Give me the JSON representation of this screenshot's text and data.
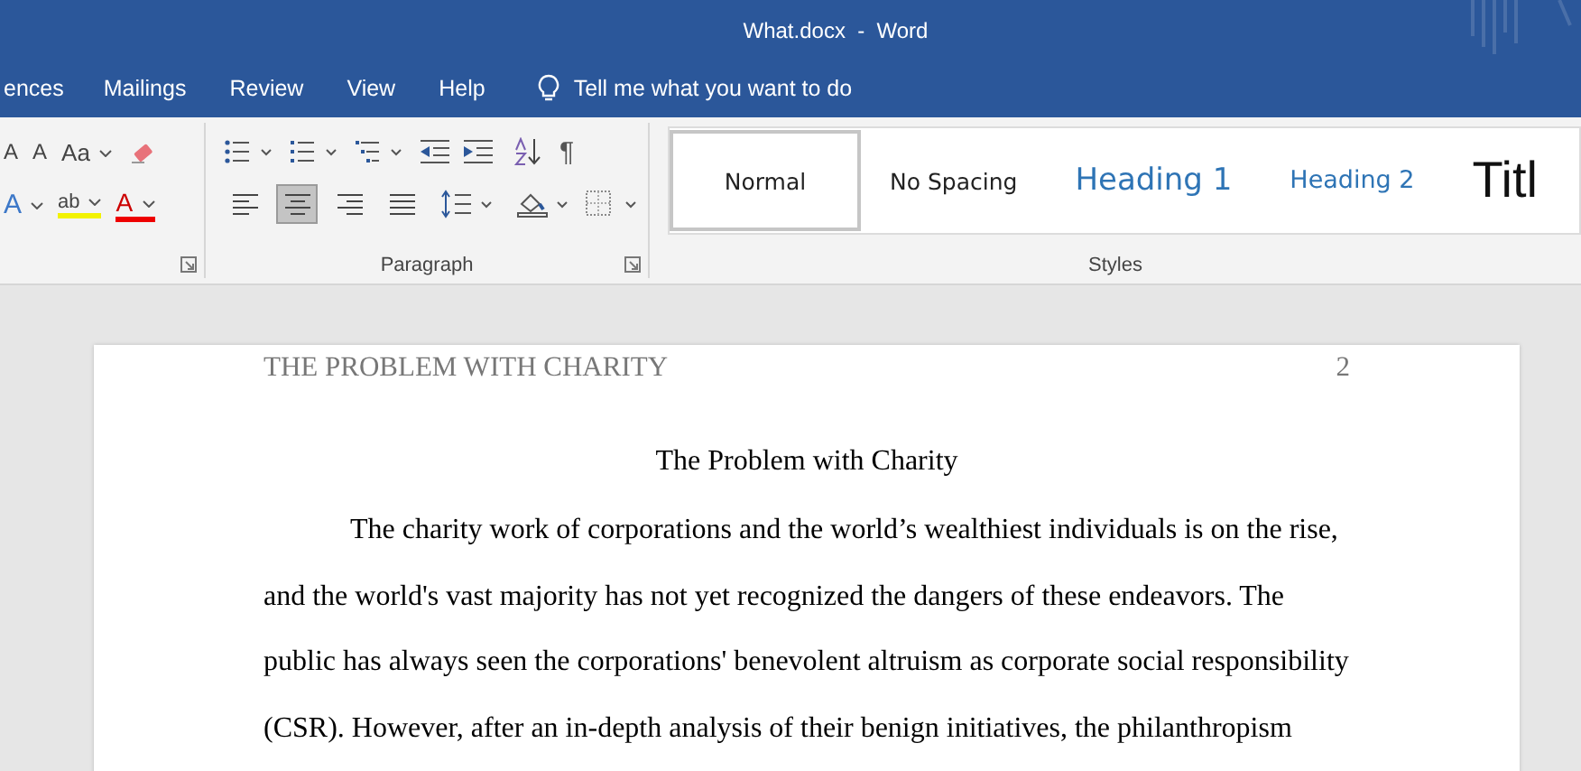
{
  "window": {
    "title": "What.docx  -  Word"
  },
  "ribbon_tabs": [
    {
      "label": "ences",
      "selected": false
    },
    {
      "label": "Mailings",
      "selected": false
    },
    {
      "label": "Review",
      "selected": false
    },
    {
      "label": "View",
      "selected": false
    },
    {
      "label": "Help",
      "selected": false
    }
  ],
  "tell_me": {
    "placeholder": "Tell me what you want to do"
  },
  "font_group": {
    "row1": [
      {
        "kind": "grow",
        "label": "A"
      },
      {
        "kind": "shrink",
        "label": "A"
      },
      {
        "kind": "case",
        "label": "Aa"
      },
      {
        "kind": "clear"
      }
    ],
    "row2": [
      {
        "kind": "effects",
        "label": "A"
      },
      {
        "kind": "highlight",
        "label": "ab"
      },
      {
        "kind": "color",
        "label": "A"
      }
    ]
  },
  "paragraph_group": {
    "label": "Paragraph",
    "row1": [
      {
        "kind": "bullets"
      },
      {
        "kind": "numbering"
      },
      {
        "kind": "multilevel"
      },
      {
        "kind": "outdent"
      },
      {
        "kind": "indent"
      },
      {
        "kind": "sort"
      },
      {
        "kind": "pilcrow",
        "label": "¶"
      }
    ],
    "alignment": [
      {
        "kind": "left",
        "selected": false
      },
      {
        "kind": "center",
        "selected": true
      },
      {
        "kind": "right",
        "selected": false
      },
      {
        "kind": "justify",
        "selected": false
      }
    ],
    "row2": [
      {
        "kind": "spacing"
      },
      {
        "kind": "shading"
      },
      {
        "kind": "borders"
      }
    ]
  },
  "styles_group": {
    "label": "Styles",
    "styles": [
      {
        "label": "Normal",
        "kind": "normal",
        "selected": true
      },
      {
        "label": "No Spacing",
        "kind": "normal",
        "selected": false
      },
      {
        "label": "Heading 1",
        "kind": "heading1",
        "selected": false
      },
      {
        "label": "Heading 2",
        "kind": "heading2",
        "selected": false
      },
      {
        "label": "Titl",
        "kind": "title",
        "selected": false
      }
    ]
  },
  "document": {
    "header": "THE PROBLEM WITH CHARITY",
    "page_number": "2",
    "title": "The Problem with Charity",
    "paragraph": "The charity work of corporations and the world’s wealthiest individuals is on the rise, and the world's vast majority has not yet recognized the dangers of these endeavors. The public has always seen the corporations' benevolent altruism as corporate social responsibility (CSR). However, after an in-depth analysis of their benign initiatives, the philanthropism"
  }
}
